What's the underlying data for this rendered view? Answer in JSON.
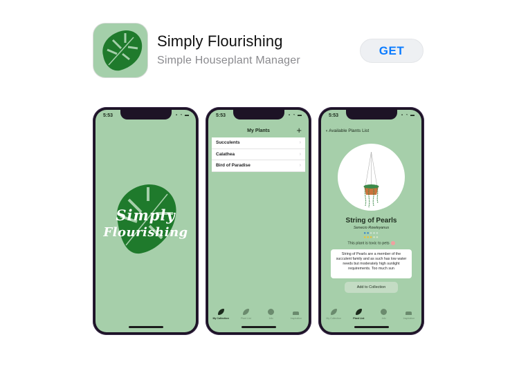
{
  "header": {
    "app_name": "Simply Flourishing",
    "subtitle": "Simple Houseplant Manager",
    "get_label": "GET",
    "icon": "monstera-leaf-icon"
  },
  "colors": {
    "screen_bg": "#a6cfaa",
    "leaf_green": "#1f7a2c",
    "get_blue": "#0a7bff",
    "phone_frame": "#1d1326"
  },
  "screens": [
    {
      "status_time": "5:53",
      "splash_line1": "Simply",
      "splash_line2": "Flourishing"
    },
    {
      "status_time": "5:53",
      "nav_title": "My Plants",
      "plus": "+",
      "plants": [
        "Succulents",
        "Calathea",
        "Bird of Paradise"
      ],
      "tabs": [
        "My Collection",
        "Plant List",
        "Info",
        "Inspiration"
      ],
      "active_tab": "My Collection"
    },
    {
      "status_time": "5:53",
      "back_label": "Available Plants List",
      "plant_name": "String of Pearls",
      "scientific_name": "Senecio Rowleyanus",
      "water_level": 2,
      "water_max": 5,
      "sun_level": 3,
      "sun_max": 5,
      "toxicity": "This plant is toxic to pets",
      "description": "String of Pearls are a member of the succulent family and as such has low water needs but moderately high sunlight requirements. Too much sun",
      "add_button": "Add to Collection",
      "tabs": [
        "My Collection",
        "Plant List",
        "Info",
        "Inspiration"
      ],
      "active_tab": "Plant List"
    }
  ]
}
